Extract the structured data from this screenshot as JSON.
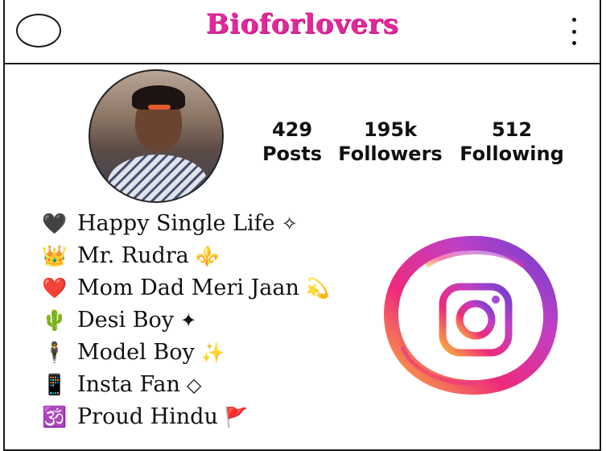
{
  "header": {
    "brand": "Bioforlovers"
  },
  "profile": {
    "stats": [
      {
        "value": "429",
        "label": "Posts"
      },
      {
        "value": "195k",
        "label": "Followers"
      },
      {
        "value": "512",
        "label": "Following"
      }
    ]
  },
  "bio": [
    {
      "emoji": "🖤",
      "text": "Happy Single Life",
      "trail": "✧"
    },
    {
      "emoji": "👑",
      "text": "Mr. Rudra",
      "trail": "⚜️"
    },
    {
      "emoji": "❤️",
      "text": "Mom Dad Meri Jaan",
      "trail": "💫"
    },
    {
      "emoji": "🌵",
      "text": "Desi Boy",
      "trail": "✦"
    },
    {
      "emoji": "🕴",
      "text": "Model Boy",
      "trail": "✨"
    },
    {
      "emoji": "📱",
      "text": "Insta Fan",
      "trail": "◇"
    },
    {
      "emoji": "🕉️",
      "text": "Proud Hindu",
      "trail": "🚩"
    }
  ],
  "colors": {
    "brand": "#e0299a",
    "border": "#1a1a1a",
    "insta_gradient": [
      "#f9b43b",
      "#ee2a7b",
      "#a84ad6",
      "#6a3fd0"
    ]
  },
  "icons": {
    "header_left": "circle-outline-icon",
    "header_right": "more-vertical-icon",
    "logo": "instagram-logo-icon"
  }
}
